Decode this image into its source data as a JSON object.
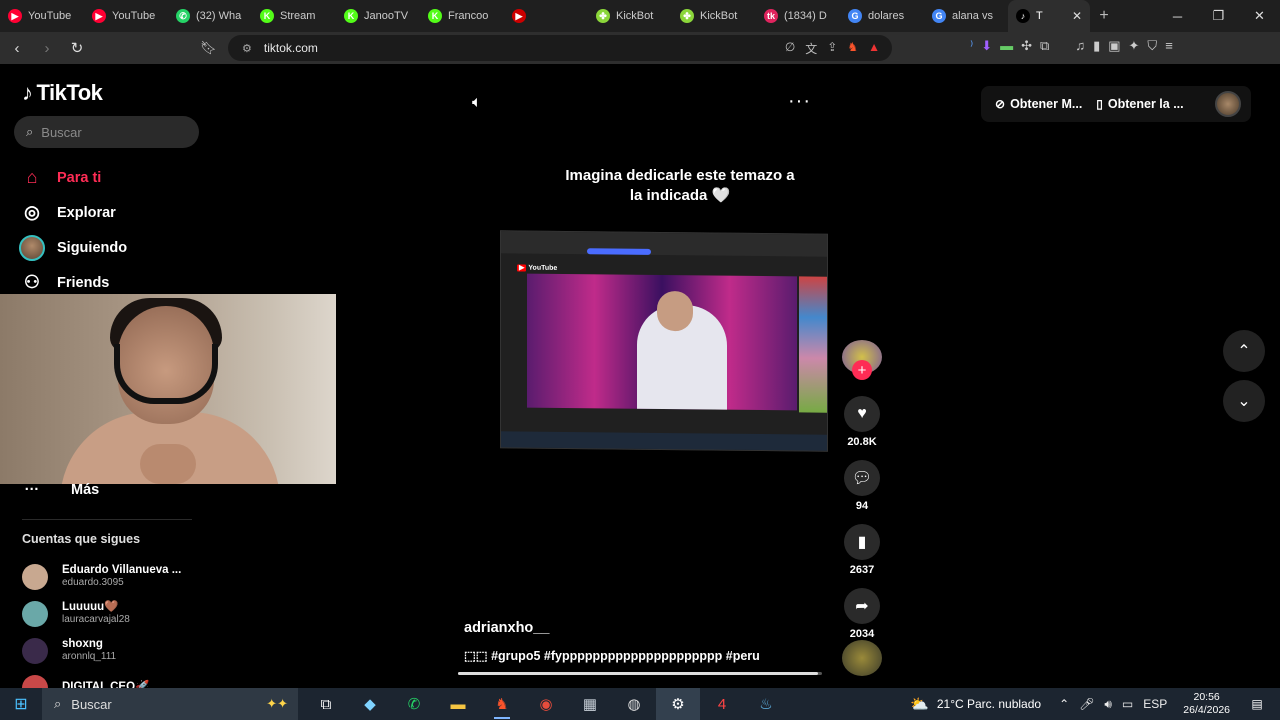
{
  "browser": {
    "tabs": [
      {
        "label": "YouTube",
        "icon": "youtube-icon",
        "color": "#ff0033",
        "glyph": "▶"
      },
      {
        "label": "YouTube",
        "icon": "youtube-icon",
        "color": "#ff0033",
        "glyph": "▶"
      },
      {
        "label": "(32) Wha",
        "icon": "whatsapp-icon",
        "color": "#25d366",
        "glyph": "✆"
      },
      {
        "label": "Stream",
        "icon": "kick-icon",
        "color": "#53fc18",
        "glyph": "K"
      },
      {
        "label": "JanooTV",
        "icon": "kick-icon",
        "color": "#53fc18",
        "glyph": "K"
      },
      {
        "label": "Francoo",
        "icon": "kick-icon",
        "color": "#53fc18",
        "glyph": "K"
      },
      {
        "label": "",
        "icon": "multi-icon",
        "color": "#cc0000",
        "glyph": "▶"
      },
      {
        "label": "KickBot",
        "icon": "kickbot-icon",
        "color": "#8bd63a",
        "glyph": "✤"
      },
      {
        "label": "KickBot",
        "icon": "kickbot-icon",
        "color": "#8bd63a",
        "glyph": "✤"
      },
      {
        "label": "(1834) D",
        "icon": "tiktok-live-icon",
        "color": "#e0245e",
        "glyph": "tk"
      },
      {
        "label": "dolares",
        "icon": "google-icon",
        "color": "#4285f4",
        "glyph": "G"
      },
      {
        "label": "alana vs",
        "icon": "google-icon",
        "color": "#4285f4",
        "glyph": "G"
      },
      {
        "label": "T",
        "icon": "tiktok-icon",
        "color": "#000000",
        "glyph": "♪",
        "active": true
      }
    ],
    "url": "tiktok.com"
  },
  "tiktok": {
    "logo": "TikTok",
    "search_placeholder": "Buscar",
    "nav": [
      {
        "label": "Para ti",
        "icon": "home-icon",
        "glyph": "⌂",
        "active": true
      },
      {
        "label": "Explorar",
        "icon": "compass-icon",
        "glyph": "◎"
      },
      {
        "label": "Siguiendo",
        "icon": "following-avatar",
        "glyph": ""
      },
      {
        "label": "Friends",
        "icon": "friends-icon",
        "glyph": "⚇"
      }
    ],
    "more_label": "Más",
    "following_title": "Cuentas que sigues",
    "accounts": [
      {
        "name": "Eduardo Villanueva ...",
        "user": "eduardo.3095",
        "color": "#c8a890"
      },
      {
        "name": "Luuuuu🤎",
        "user": "lauracarvajal28",
        "color": "#6aa8a8"
      },
      {
        "name": "shoxng",
        "user": "aronnlq_111",
        "color": "#3a2a4a"
      },
      {
        "name": "DIGITAL CEO🚀",
        "user": "",
        "color": "#c84848"
      }
    ],
    "get_app": [
      {
        "label": "Obtener M...",
        "icon": "coin-icon",
        "glyph": "⊘"
      },
      {
        "label": "Obtener la ...",
        "icon": "phone-icon",
        "glyph": "▯"
      }
    ],
    "video": {
      "caption": "Imagina dedicarle este temazo a la indicada 🤍",
      "author": "adrianxho__",
      "description": "⬚⬚ #grupo5 #fyppppppppppppppppppppp #peru",
      "progress": 0.99,
      "likes": "20.8K",
      "comments": "94",
      "saves": "2637",
      "shares": "2034"
    }
  },
  "taskbar": {
    "search_placeholder": "Buscar",
    "apps": [
      {
        "icon": "task-view-icon",
        "glyph": "⧉",
        "color": "#ffffff"
      },
      {
        "icon": "files-icon",
        "glyph": "◆",
        "color": "#7fd3ff"
      },
      {
        "icon": "whatsapp-icon",
        "glyph": "✆",
        "color": "#25d366"
      },
      {
        "icon": "file-explorer-icon",
        "glyph": "▬",
        "color": "#f5c542"
      },
      {
        "icon": "brave-icon",
        "glyph": "♞",
        "color": "#fb542b",
        "open": true
      },
      {
        "icon": "chrome-icon",
        "glyph": "◉",
        "color": "#e74c3c"
      },
      {
        "icon": "calculator-icon",
        "glyph": "▦",
        "color": "#c8d0d8"
      },
      {
        "icon": "obs-icon",
        "glyph": "◍",
        "color": "#dddddd"
      },
      {
        "icon": "settings-icon",
        "glyph": "⚙",
        "color": "#ffffff",
        "focused": true
      },
      {
        "icon": "app-4-icon",
        "glyph": "4",
        "color": "#ff4444"
      },
      {
        "icon": "steam-icon",
        "glyph": "♨",
        "color": "#66c0f4"
      }
    ],
    "weather": "21°C  Parc. nublado",
    "language": "ESP",
    "time": "20:56",
    "date": "26/4/2026"
  }
}
